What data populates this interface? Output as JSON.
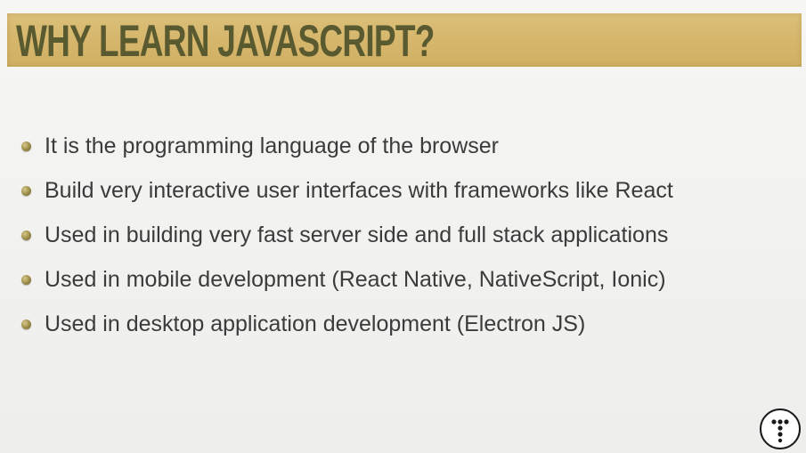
{
  "slide": {
    "title": "WHY LEARN JAVASCRIPT?",
    "bullets": [
      "It is the programming language of the browser",
      "Build very interactive user interfaces with frameworks like React",
      "Used in building very fast server side and full stack applications",
      "Used in mobile development (React Native, NativeScript, Ionic)",
      "Used in desktop application development (Electron JS)"
    ]
  },
  "colors": {
    "title_band": "#d6b76d",
    "title_text": "#5a5a30",
    "bullet_text": "#3b3b3b",
    "bullet_dot": "#9a8a46",
    "background": "#f3f3f1"
  },
  "icons": {
    "bullet": "bullet-dot-icon",
    "logo": "channel-logo-icon"
  }
}
